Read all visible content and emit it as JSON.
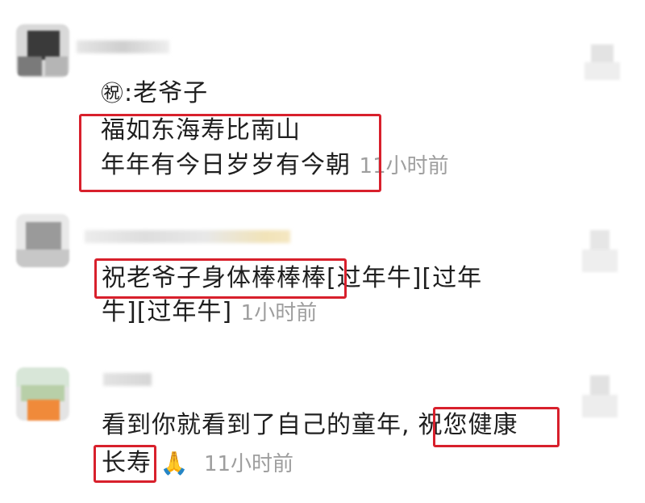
{
  "colors": {
    "highlight": "#d8202c",
    "timestamp": "#9e9e9e",
    "text": "#1f1f1f"
  },
  "comments": [
    {
      "header": {
        "glyph": "㊗",
        "text": ":老爷子"
      },
      "line1": "福如东海寿比南山",
      "line2": "年年有今日岁岁有今朝",
      "time": "11小时前"
    },
    {
      "line1_highlight": "祝老爷子身体棒棒棒",
      "line1_rest": "[过年牛][过年",
      "line2": "牛][过年牛]",
      "time": "1小时前"
    },
    {
      "line1_start": "看到你就看到了自己的童年",
      "line1_punct": ",",
      "line1_highlight": "祝您健康",
      "line2_highlight": "长寿",
      "emoji": "folded-hands",
      "time": "11小时前"
    }
  ]
}
